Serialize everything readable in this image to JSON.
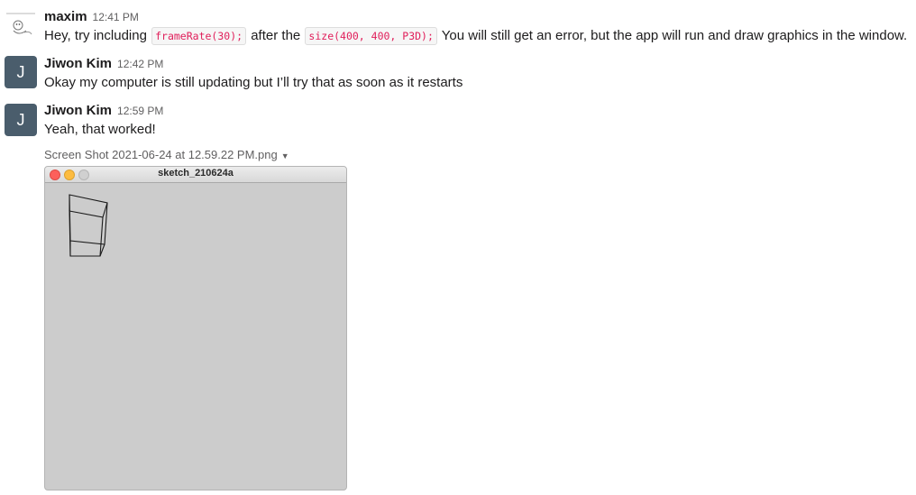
{
  "messages": [
    {
      "author": "maxim",
      "time": "12:41 PM",
      "text_parts": {
        "t1": "Hey, try including ",
        "code1": "frameRate(30);",
        "t2": " after the ",
        "code2": "size(400, 400, P3D);",
        "t3": " You will still get an error, but the app will run and draw graphics in the window."
      }
    },
    {
      "author": "Jiwon Kim",
      "avatar_initial": "J",
      "time": "12:42 PM",
      "text": "Okay my computer is still updating but I’ll try that as soon as it restarts"
    },
    {
      "author": "Jiwon Kim",
      "avatar_initial": "J",
      "time": "12:59 PM",
      "text": "Yeah, that worked!",
      "attachment": {
        "file_name": "Screen Shot 2021-06-24 at 12.59.22 PM.png",
        "window_title": "sketch_210624a"
      }
    }
  ],
  "colors": {
    "close": "#fc605b",
    "minimize": "#fdbc40",
    "zoom_inactive": "#d0d0d0",
    "avatar_bg": "#4a5d6c",
    "code_text": "#e01e5a",
    "canvas_bg": "#cccccc"
  },
  "icons": {
    "dropdown": "caret-down-icon"
  }
}
